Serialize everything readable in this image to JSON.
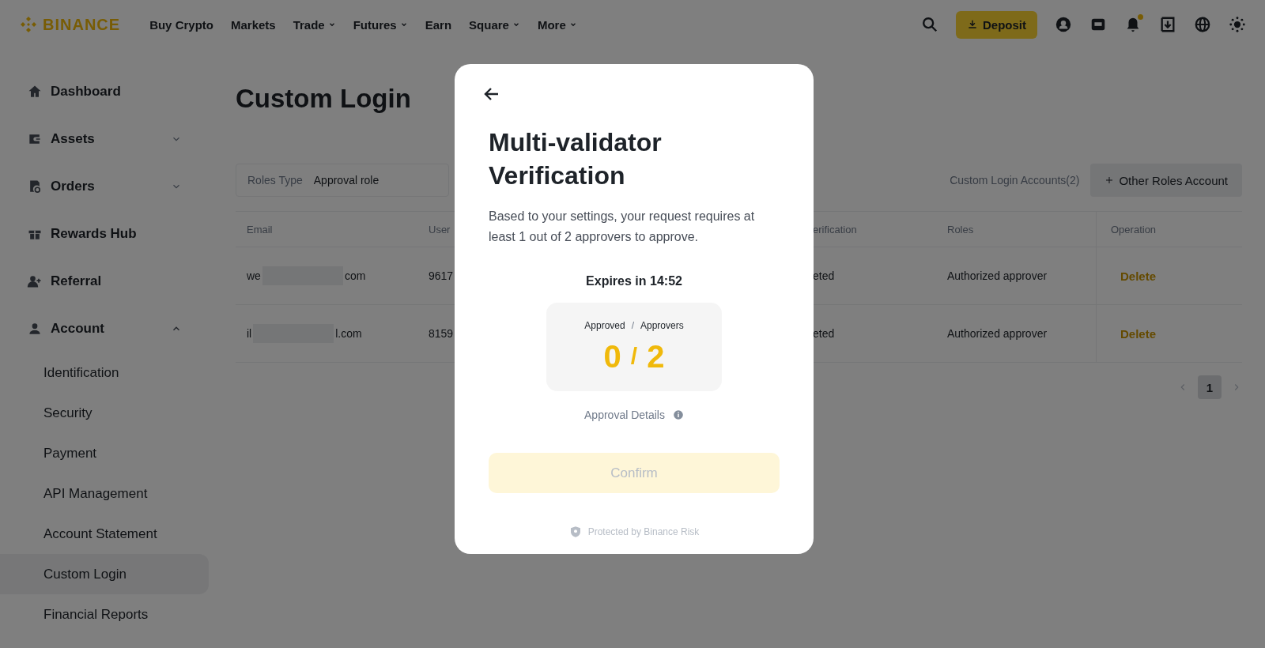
{
  "header": {
    "logo": "BINANCE",
    "nav": [
      {
        "label": "Buy Crypto",
        "dropdown": false
      },
      {
        "label": "Markets",
        "dropdown": false
      },
      {
        "label": "Trade",
        "dropdown": true
      },
      {
        "label": "Futures",
        "dropdown": true
      },
      {
        "label": "Earn",
        "dropdown": false
      },
      {
        "label": "Square",
        "dropdown": true
      },
      {
        "label": "More",
        "dropdown": true
      }
    ],
    "deposit": "Deposit",
    "notification_dot": true
  },
  "sidebar": {
    "items": [
      {
        "label": "Dashboard"
      },
      {
        "label": "Assets",
        "expanded": false
      },
      {
        "label": "Orders",
        "expanded": false
      },
      {
        "label": "Rewards Hub"
      },
      {
        "label": "Referral"
      },
      {
        "label": "Account",
        "expanded": true,
        "children": [
          {
            "label": "Identification",
            "selected": false
          },
          {
            "label": "Security",
            "selected": false
          },
          {
            "label": "Payment",
            "selected": false
          },
          {
            "label": "API Management",
            "selected": false
          },
          {
            "label": "Account Statement",
            "selected": false
          },
          {
            "label": "Custom Login",
            "selected": true
          },
          {
            "label": "Financial Reports",
            "selected": false
          }
        ]
      }
    ]
  },
  "page": {
    "title": "Custom Login",
    "filter": {
      "label": "Roles Type",
      "value": "Approval role"
    },
    "accounts_count": "Custom Login Accounts(2)",
    "add_button": "Other Roles Account",
    "table": {
      "columns": [
        "Email",
        "User",
        "erification",
        "Roles",
        "Operation"
      ],
      "rows": [
        {
          "email_start": "we",
          "email_end": "com",
          "user": "9617",
          "verification": "eted",
          "role": "Authorized approver",
          "action": "Delete"
        },
        {
          "email_start": "il",
          "email_end": "l.com",
          "user": "8159",
          "verification": "eted",
          "role": "Authorized approver",
          "action": "Delete"
        }
      ]
    },
    "pagination": {
      "pages": [
        {
          "label": "1",
          "selected": true
        }
      ]
    }
  },
  "modal": {
    "title": "Multi-validator Verification",
    "description": "Based to your settings, your request requires at least 1 out of 2 approvers to approve.",
    "expires": "Expires in 14:52",
    "counter": {
      "label_left": "Approved",
      "separator": "/",
      "label_right": "Approvers",
      "approved": "0",
      "divider": "/",
      "total": "2"
    },
    "details": "Approval Details",
    "confirm": {
      "label": "Confirm",
      "disabled": true
    },
    "footer": "Protected by Binance Risk"
  }
}
